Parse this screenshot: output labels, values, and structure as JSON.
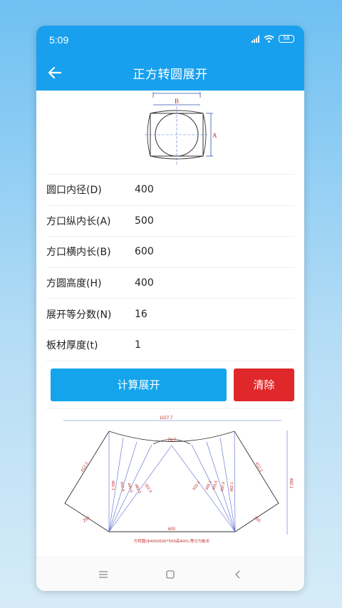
{
  "status": {
    "time": "5:09",
    "battery": "58"
  },
  "appbar": {
    "title": "正方转圆展开"
  },
  "top_diagram": {
    "label_b": "B",
    "label_a": "A"
  },
  "fields": [
    {
      "label": "圆口内径(D)",
      "value": "400"
    },
    {
      "label": "方口纵内长(A)",
      "value": "500"
    },
    {
      "label": "方口横内长(B)",
      "value": "600"
    },
    {
      "label": "方圆高度(H)",
      "value": "400"
    },
    {
      "label": "展开等分数(N)",
      "value": "16"
    },
    {
      "label": "板材厚度(t)",
      "value": "1"
    }
  ],
  "buttons": {
    "calculate": "计算展开",
    "clear": "清除"
  },
  "result": {
    "width": "1027.7",
    "top_gap": "78.7",
    "bottom": "600",
    "left_side": "412.2",
    "right_side": "412.2",
    "height": "482.1",
    "corner_left": "250",
    "corner_right": "250",
    "caption": "方转圆(Φ400/600*500高400),等分为板长",
    "left_lines": [
      "482.1",
      "450.9",
      "445.6",
      "489.3",
      "502.4"
    ],
    "right_lines": [
      "502.4",
      "489.3",
      "445.6",
      "450.9",
      "482.1"
    ]
  },
  "colors": {
    "primary": "#18a0ee",
    "danger": "#e0282a"
  }
}
